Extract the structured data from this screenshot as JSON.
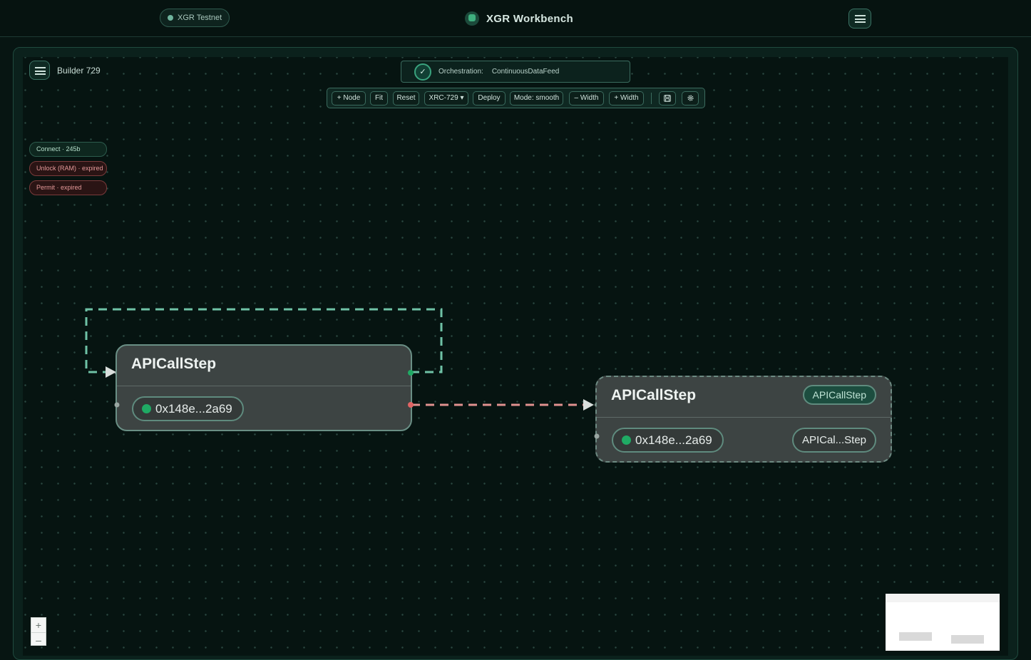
{
  "header": {
    "network_label": "XGR Testnet",
    "app_title": "XGR Workbench"
  },
  "builder": {
    "label": "Builder 729"
  },
  "orchestration": {
    "label": "Orchestration:",
    "value": "ContinuousDataFeed"
  },
  "toolbar": {
    "add_node": "+ Node",
    "fit": "Fit",
    "reset": "Reset",
    "standard": "XRC-729 ▾",
    "deploy": "Deploy",
    "mode": "Mode: smooth",
    "width_minus": "– Width",
    "width_plus": "+ Width",
    "save_icon": "save-icon",
    "settings_icon": "gear-icon"
  },
  "status": [
    {
      "label": "Connect · 245b",
      "state": "ok"
    },
    {
      "label": "Unlock (RAM) · expired",
      "state": "expired"
    },
    {
      "label": "Permit · expired",
      "state": "expired"
    }
  ],
  "nodes": [
    {
      "title": "APICallStep",
      "address": "0x148e...2a69"
    },
    {
      "title": "APICallStep",
      "address": "0x148e...2a69",
      "type_tag": "APICallStep",
      "name_tag": "APICal...Step"
    }
  ],
  "zoom": {
    "in": "+",
    "out": "–"
  },
  "colors": {
    "accent": "#3fb07f",
    "loop_edge": "#6fc2a6",
    "data_edge": "#e0918f",
    "error": "#e59a9a"
  }
}
